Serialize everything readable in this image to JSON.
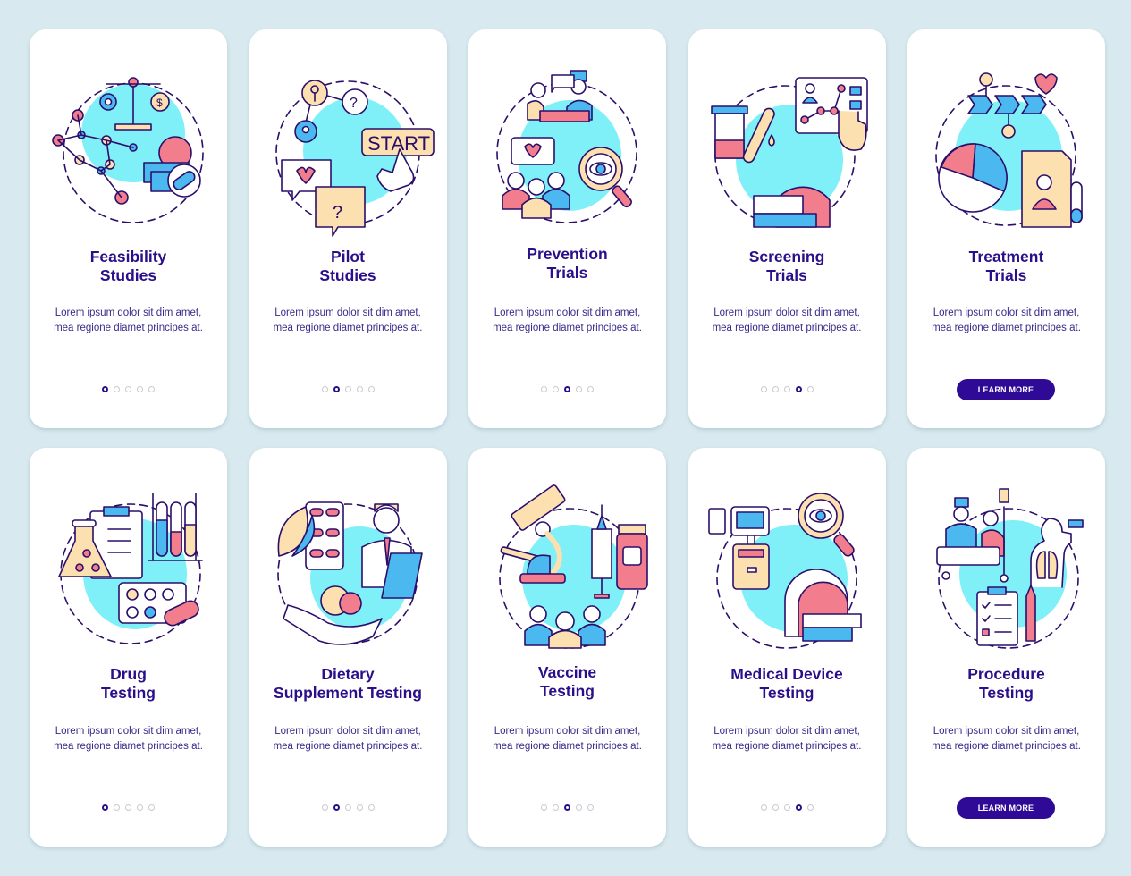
{
  "colors": {
    "background": "#d8eaef",
    "card": "#ffffff",
    "title": "#2b0e8a",
    "button": "#2e0a96",
    "accent_cyan": "#7ff0f7",
    "accent_blue": "#4bb8f0",
    "accent_pink": "#f27d8c",
    "accent_peach": "#fde0b0",
    "outline": "#2b0e6a"
  },
  "cards": [
    {
      "title": "Feasibility\nStudies",
      "description": "Lorem ipsum dolor sit dim amet, mea regione diamet principes at.",
      "active_page": 1,
      "total_pages": 5,
      "icon": "scale-gear-molecule-money-pill-icon",
      "button": null
    },
    {
      "title": "Pilot\nStudies",
      "description": "Lorem ipsum dolor sit dim amet, mea regione diamet principes at.",
      "active_page": 2,
      "total_pages": 5,
      "icon": "key-start-button-chat-icon",
      "button": null
    },
    {
      "title": "Prevention\nTrials",
      "description": "Lorem ipsum dolor sit dim amet, mea regione diamet principes at.",
      "active_page": 3,
      "total_pages": 5,
      "icon": "doctor-consultation-magnifier-group-icon",
      "button": null
    },
    {
      "title": "Screening\nTrials",
      "description": "Lorem ipsum dolor sit dim amet, mea regione diamet principes at.",
      "active_page": 4,
      "total_pages": 5,
      "icon": "test-tube-mri-chart-icon",
      "button": null
    },
    {
      "title": "Treatment\nTrials",
      "description": "Lorem ipsum dolor sit dim amet, mea regione diamet principes at.",
      "active_page": null,
      "total_pages": 5,
      "icon": "process-pie-chart-folder-icon",
      "button": "LEARN MORE"
    },
    {
      "title": "Drug\nTesting",
      "description": "Lorem ipsum dolor sit dim amet, mea regione diamet principes at.",
      "active_page": 1,
      "total_pages": 5,
      "icon": "flask-test-tubes-pills-icon",
      "button": null
    },
    {
      "title": "Dietary\nSupplement Testing",
      "description": "Lorem ipsum dolor sit dim amet, mea regione diamet principes at.",
      "active_page": 2,
      "total_pages": 5,
      "icon": "leaf-pills-doctor-hand-icon",
      "button": null
    },
    {
      "title": "Vaccine\nTesting",
      "description": "Lorem ipsum dolor sit dim amet, mea regione diamet principes at.",
      "active_page": 3,
      "total_pages": 5,
      "icon": "microscope-syringe-vial-group-icon",
      "button": null
    },
    {
      "title": "Medical Device\nTesting",
      "description": "Lorem ipsum dolor sit dim amet, mea regione diamet principes at.",
      "active_page": 4,
      "total_pages": 5,
      "icon": "monitor-magnifier-mri-icon",
      "button": null
    },
    {
      "title": "Procedure\nTesting",
      "description": "Lorem ipsum dolor sit dim amet, mea regione diamet principes at.",
      "active_page": null,
      "total_pages": 5,
      "icon": "surgery-lungs-clipboard-icon",
      "button": "LEARN MORE"
    }
  ]
}
